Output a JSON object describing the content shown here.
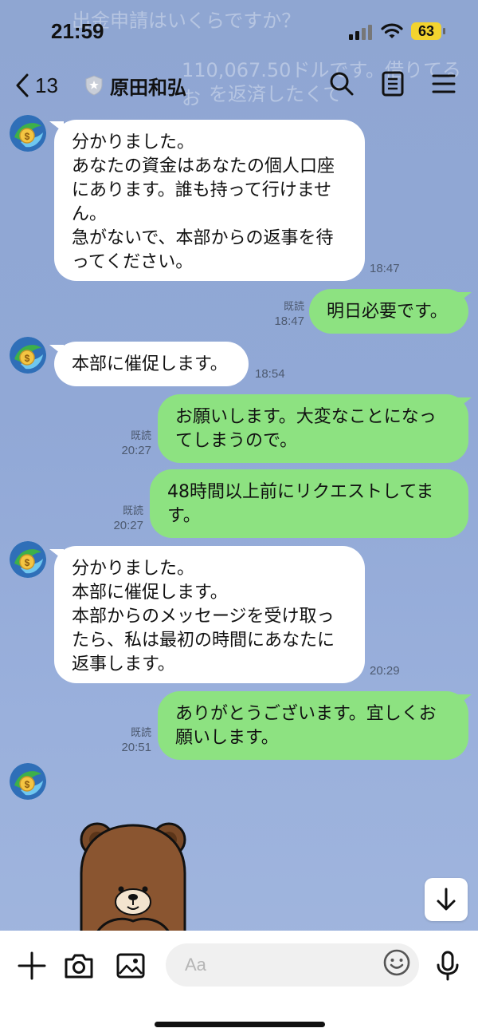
{
  "status_bar": {
    "time": "21:59",
    "battery": "63"
  },
  "background_messages": [
    {
      "text": "出金申請はいくらですか？"
    },
    {
      "text": "110,067.50ドルです。借りてるお"
    },
    {
      "text": "を返済したくて"
    }
  ],
  "header": {
    "back_count": "13",
    "contact_name": "原田和弘"
  },
  "messages": [
    {
      "text": "分かりました。\nあなたの資金はあなたの個人口座\nにあります。誰も持って行けませ\nん。\n急がないで、本部からの返事を待\nってください。",
      "time": "18:47"
    },
    {
      "text": "明日必要です。",
      "read": "既読",
      "time": "18:47"
    },
    {
      "text": "本部に催促します。",
      "time": "18:54"
    },
    {
      "text": "お願いします。大変なことになっ\nてしまうので。",
      "read": "既読",
      "time": "20:27"
    },
    {
      "text": "48時間以上前にリクエストしてま\nす。",
      "read": "既読",
      "time": "20:27"
    },
    {
      "text": "分かりました。\n本部に催促します。\n本部からのメッセージを受け取っ\nたら、私は最初の時間にあなたに\n返事します。",
      "time": "20:29"
    },
    {
      "text": "ありがとうございます。宜しくお\n願いします。",
      "read": "既読",
      "time": "20:51"
    }
  ],
  "input": {
    "placeholder": "Aa"
  },
  "colors": {
    "background": "#91a8d6",
    "outgoing_bubble": "#8de281",
    "incoming_bubble": "#ffffff",
    "battery": "#f2d32f"
  },
  "icons": [
    "back-chevron-icon",
    "shield-icon",
    "search-icon",
    "notes-icon",
    "menu-icon",
    "scroll-down-icon",
    "plus-icon",
    "camera-icon",
    "image-icon",
    "emoji-icon",
    "microphone-icon"
  ]
}
